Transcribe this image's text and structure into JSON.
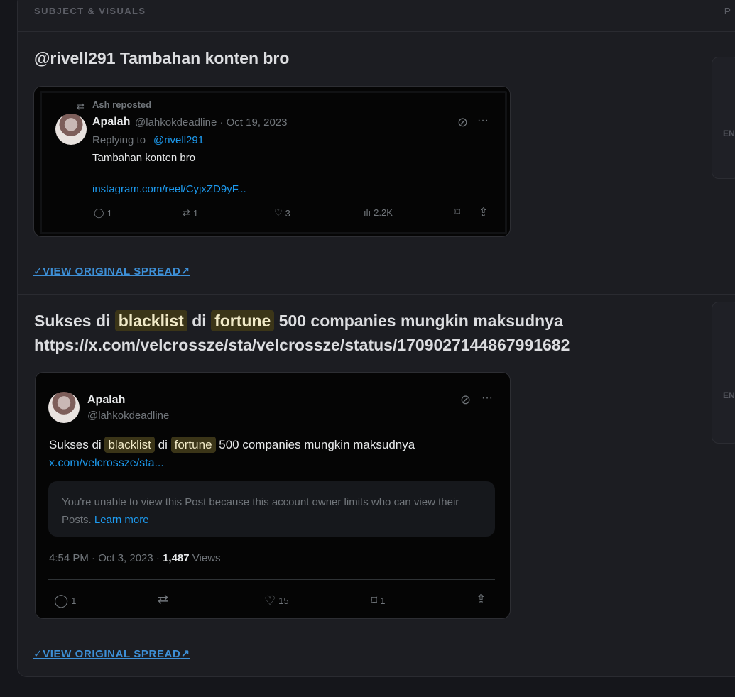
{
  "header": {
    "column_left": "SUBJECT & VISUALS",
    "column_right": "P"
  },
  "side_cards": [
    {
      "label": "EN"
    },
    {
      "label": "EN"
    }
  ],
  "posts": [
    {
      "title": "@rivell291 Tambahan konten bro",
      "tweet": {
        "repost_label": "Ash reposted",
        "author_name": "Apalah",
        "author_meta": "@lahkokdeadline · Oct 19, 2023",
        "replying_prefix": "Replying to",
        "replying_handle": "@rivell291",
        "text": "Tambahan konten bro",
        "link": "instagram.com/reel/CyjxZD9yF...",
        "stats": {
          "replies": "1",
          "reposts": "1",
          "likes": "3",
          "views": "2.2K"
        }
      },
      "view_link": "VIEW ORIGINAL SPREAD"
    },
    {
      "title_parts": {
        "t1": "Sukses di ",
        "hl1": "blacklist",
        "t2": " di ",
        "hl2": "fortune",
        "t3": " 500 companies mungkin maksudnya",
        "line2": "https://x.com/velcrossze/sta/velcrossze/status/1709027144867991682"
      },
      "tweet": {
        "author_name": "Apalah",
        "author_handle": "@lahkokdeadline",
        "text_parts": {
          "t1": "Sukses di ",
          "hl1": "blacklist",
          "t2": " di ",
          "hl2": "fortune",
          "t3": " 500 companies mungkin maksudnya"
        },
        "link": "x.com/velcrossze/sta...",
        "notice_text": "You're unable to view this Post because this account owner limits who can view their Posts.",
        "notice_link": "Learn more",
        "timestamp": "4:54 PM · Oct 3, 2023 · ",
        "views_count": "1,487",
        "views_label": " Views",
        "stats": {
          "replies": "1",
          "likes": "15",
          "bookmarks": "1"
        }
      },
      "view_link": "VIEW ORIGINAL SPREAD"
    }
  ],
  "icons": {
    "repost": "⇄",
    "reply": "◯",
    "like": "♡",
    "views": "ılı",
    "bookmark": "⌑",
    "share": "⇪",
    "more": "···",
    "grok": "⊘",
    "external": "↗",
    "bird": "✓"
  }
}
